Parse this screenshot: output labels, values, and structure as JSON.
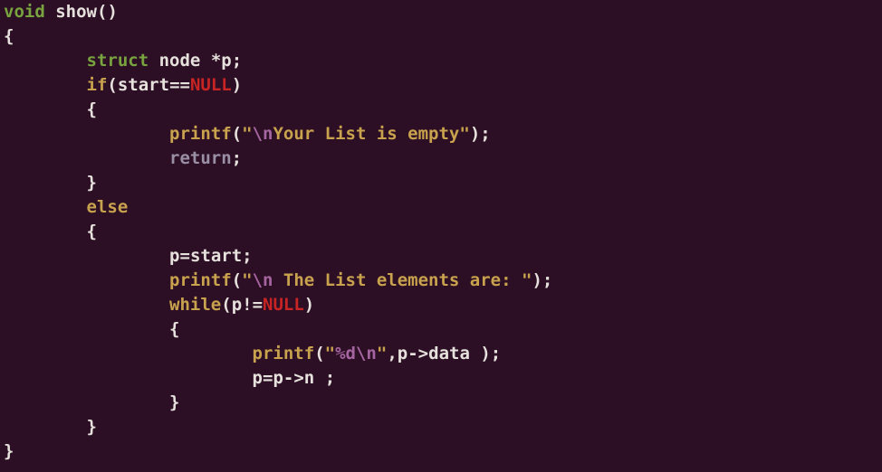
{
  "t": {
    "void": "void",
    "show": "show",
    "struct": "struct",
    "node": "node",
    "p": "p",
    "if": "if",
    "start": "start",
    "eq": "==",
    "NULL": "NULL",
    "printf": "printf",
    "str_empty_pre": "\"",
    "esc_n": "\\n",
    "str_empty_mid": "Your List is empty",
    "str_empty_post": "\"",
    "return": "return",
    "else": "else",
    "assign": "=",
    "str_elems_pre": "\"",
    "str_elems_mid": " The List elements are: ",
    "str_elems_post": "\"",
    "while": "while",
    "neq": "!=",
    "str_fmt_pre": "\"",
    "fmt_d": "%d",
    "str_fmt_post": "\"",
    "data": "data",
    "n": "n",
    "arrow": "->",
    "star": "*",
    "semi": ";",
    "comma": ",",
    "lparen": "(",
    "rparen": ")",
    "lbrace": "{",
    "rbrace": "}",
    "space": " "
  }
}
